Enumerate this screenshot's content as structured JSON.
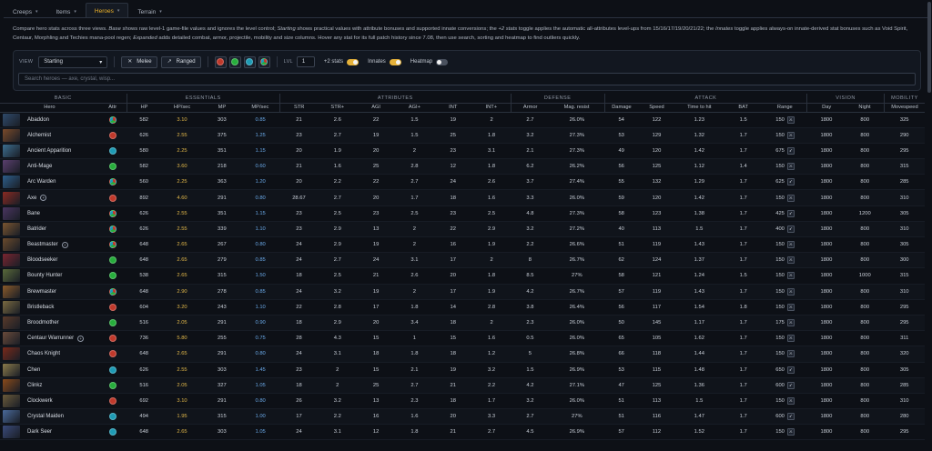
{
  "tabs": [
    {
      "label": "Creeps",
      "active": false
    },
    {
      "label": "Items",
      "active": false
    },
    {
      "label": "Heroes",
      "active": true
    },
    {
      "label": "Terrain",
      "active": false
    }
  ],
  "description_html": "Compare hero stats across three views. <i>Base</i> shows raw level-1 game-file values and ignores the level control; <i>Starting</i> shows practical values with attribute bonuses and supported innate conversions; the <i>+2 stats</i> toggle applies the automatic all-attributes level-ups from 15/16/17/19/20/21/22; the <i>Innates</i> toggle applies always-on innate-derived stat bonuses such as Void Spirit, Centaur, Morphling and Techies mana-pool regen; <i>Expanded</i> adds detailed combat, armor, projectile, mobility and size columns. Hover any stat for its full patch history since 7.08, then use search, sorting and heatmap to find outliers quickly.",
  "toolbar": {
    "view_label": "VIEW",
    "view_value": "Starting",
    "melee_label": "Melee",
    "ranged_label": "Ranged",
    "lvl_label": "LVL",
    "lvl_value": "1",
    "plus2_label": "+2 stats",
    "innates_label": "Innates",
    "heatmap_label": "Heatmap",
    "search_placeholder": "Search heroes — axe, crystal, wisp..."
  },
  "colors": {
    "str": "#c0392b",
    "agi": "#27ae3c",
    "int": "#1e9bb5",
    "accent": "#e6b23a"
  },
  "groups": [
    "BASIC",
    "ESSENTIALS",
    "ATTRIBUTES",
    "DEFENSE",
    "ATTACK",
    "VISION",
    "MOBILITY"
  ],
  "columns": [
    "Hero",
    "Attr",
    "HP",
    "HP/sec",
    "MP",
    "MP/sec",
    "STR",
    "STR+",
    "AGI",
    "AGI+",
    "INT",
    "INT+",
    "Armor",
    "Mag. resist",
    "Damage",
    "Speed",
    "Time to hit",
    "BAT",
    "Range",
    "Day",
    "Night",
    "Movespeed"
  ],
  "heroes": [
    {
      "name": "Abaddon",
      "attr": "uni",
      "innate": false,
      "pc": "#2f4a6b",
      "hp": "582",
      "hps": "3.10",
      "mp": "303",
      "mps": "0.85",
      "str": "21",
      "strg": "2.6",
      "agi": "22",
      "agig": "1.5",
      "int": "19",
      "intg": "2",
      "arm": "2.7",
      "mr": "26.0%",
      "dmg": "54",
      "spd": "122",
      "tth": "1.23",
      "bat": "1.5",
      "rng": "150",
      "day": "1800",
      "night": "800",
      "ms": "325"
    },
    {
      "name": "Alchemist",
      "attr": "str",
      "innate": false,
      "pc": "#7a4a2a",
      "hp": "626",
      "hps": "2.55",
      "mp": "375",
      "mps": "1.25",
      "str": "23",
      "strg": "2.7",
      "agi": "19",
      "agig": "1.5",
      "int": "25",
      "intg": "1.8",
      "arm": "3.2",
      "mr": "27.3%",
      "dmg": "53",
      "spd": "129",
      "tth": "1.32",
      "bat": "1.7",
      "rng": "150",
      "day": "1800",
      "night": "800",
      "ms": "290"
    },
    {
      "name": "Ancient Apparition",
      "attr": "int",
      "innate": false,
      "pc": "#3c6e8f",
      "hp": "580",
      "hps": "2.25",
      "mp": "351",
      "mps": "1.15",
      "str": "20",
      "strg": "1.9",
      "agi": "20",
      "agig": "2",
      "int": "23",
      "intg": "3.1",
      "arm": "2.1",
      "mr": "27.3%",
      "dmg": "49",
      "spd": "120",
      "tth": "1.42",
      "bat": "1.7",
      "rng": "675",
      "day": "1800",
      "night": "800",
      "ms": "295"
    },
    {
      "name": "Anti-Mage",
      "attr": "agi",
      "innate": false,
      "pc": "#5a3f6e",
      "hp": "582",
      "hps": "3.60",
      "mp": "218",
      "mps": "0.60",
      "str": "21",
      "strg": "1.6",
      "agi": "25",
      "agig": "2.8",
      "int": "12",
      "intg": "1.8",
      "arm": "6.2",
      "mr": "26.2%",
      "dmg": "56",
      "spd": "125",
      "tth": "1.12",
      "bat": "1.4",
      "rng": "150",
      "day": "1800",
      "night": "800",
      "ms": "315"
    },
    {
      "name": "Arc Warden",
      "attr": "uni",
      "innate": false,
      "pc": "#2d5e8a",
      "hp": "560",
      "hps": "2.25",
      "mp": "363",
      "mps": "1.20",
      "str": "20",
      "strg": "2.2",
      "agi": "22",
      "agig": "2.7",
      "int": "24",
      "intg": "2.6",
      "arm": "3.7",
      "mr": "27.4%",
      "dmg": "55",
      "spd": "132",
      "tth": "1.29",
      "bat": "1.7",
      "rng": "625",
      "day": "1800",
      "night": "800",
      "ms": "285"
    },
    {
      "name": "Axe",
      "attr": "str",
      "innate": true,
      "pc": "#8a2a22",
      "hp": "892",
      "hps": "4.60",
      "mp": "291",
      "mps": "0.80",
      "str": "28.67",
      "strg": "2.7",
      "agi": "20",
      "agig": "1.7",
      "int": "18",
      "intg": "1.6",
      "arm": "3.3",
      "mr": "26.0%",
      "dmg": "59",
      "spd": "120",
      "tth": "1.42",
      "bat": "1.7",
      "rng": "150",
      "day": "1800",
      "night": "800",
      "ms": "310"
    },
    {
      "name": "Bane",
      "attr": "uni",
      "innate": false,
      "pc": "#4a3560",
      "hp": "626",
      "hps": "2.55",
      "mp": "351",
      "mps": "1.15",
      "str": "23",
      "strg": "2.5",
      "agi": "23",
      "agig": "2.5",
      "int": "23",
      "intg": "2.5",
      "arm": "4.8",
      "mr": "27.3%",
      "dmg": "58",
      "spd": "123",
      "tth": "1.38",
      "bat": "1.7",
      "rng": "425",
      "day": "1800",
      "night": "1200",
      "ms": "305"
    },
    {
      "name": "Batrider",
      "attr": "uni",
      "innate": false,
      "pc": "#7a5530",
      "hp": "626",
      "hps": "2.55",
      "mp": "339",
      "mps": "1.10",
      "str": "23",
      "strg": "2.9",
      "agi": "13",
      "agig": "2",
      "int": "22",
      "intg": "2.9",
      "arm": "3.2",
      "mr": "27.2%",
      "dmg": "40",
      "spd": "113",
      "tth": "1.5",
      "bat": "1.7",
      "rng": "400",
      "day": "1800",
      "night": "800",
      "ms": "310"
    },
    {
      "name": "Beastmaster",
      "attr": "uni",
      "innate": true,
      "pc": "#6b4a2c",
      "hp": "648",
      "hps": "2.65",
      "mp": "267",
      "mps": "0.80",
      "str": "24",
      "strg": "2.9",
      "agi": "19",
      "agig": "2",
      "int": "16",
      "intg": "1.9",
      "arm": "2.2",
      "mr": "26.6%",
      "dmg": "51",
      "spd": "119",
      "tth": "1.43",
      "bat": "1.7",
      "rng": "150",
      "day": "1800",
      "night": "800",
      "ms": "305"
    },
    {
      "name": "Bloodseeker",
      "attr": "agi",
      "innate": false,
      "pc": "#7a2530",
      "hp": "648",
      "hps": "2.65",
      "mp": "279",
      "mps": "0.85",
      "str": "24",
      "strg": "2.7",
      "agi": "24",
      "agig": "3.1",
      "int": "17",
      "intg": "2",
      "arm": "8",
      "mr": "26.7%",
      "dmg": "62",
      "spd": "124",
      "tth": "1.37",
      "bat": "1.7",
      "rng": "150",
      "day": "1800",
      "night": "800",
      "ms": "300"
    },
    {
      "name": "Bounty Hunter",
      "attr": "agi",
      "innate": false,
      "pc": "#5a6a3a",
      "hp": "538",
      "hps": "2.65",
      "mp": "315",
      "mps": "1.50",
      "str": "18",
      "strg": "2.5",
      "agi": "21",
      "agig": "2.6",
      "int": "20",
      "intg": "1.8",
      "arm": "8.5",
      "mr": "27%",
      "dmg": "58",
      "spd": "121",
      "tth": "1.24",
      "bat": "1.5",
      "rng": "150",
      "day": "1800",
      "night": "1000",
      "ms": "315"
    },
    {
      "name": "Brewmaster",
      "attr": "uni",
      "innate": false,
      "pc": "#8a5a2a",
      "hp": "648",
      "hps": "2.90",
      "mp": "278",
      "mps": "0.85",
      "str": "24",
      "strg": "3.2",
      "agi": "19",
      "agig": "2",
      "int": "17",
      "intg": "1.9",
      "arm": "4.2",
      "mr": "26.7%",
      "dmg": "57",
      "spd": "119",
      "tth": "1.43",
      "bat": "1.7",
      "rng": "150",
      "day": "1800",
      "night": "800",
      "ms": "310"
    },
    {
      "name": "Bristleback",
      "attr": "str",
      "innate": false,
      "pc": "#7a6a40",
      "hp": "604",
      "hps": "3.20",
      "mp": "243",
      "mps": "1.10",
      "str": "22",
      "strg": "2.8",
      "agi": "17",
      "agig": "1.8",
      "int": "14",
      "intg": "2.8",
      "arm": "3.8",
      "mr": "26.4%",
      "dmg": "56",
      "spd": "117",
      "tth": "1.54",
      "bat": "1.8",
      "rng": "150",
      "day": "1800",
      "night": "800",
      "ms": "295"
    },
    {
      "name": "Broodmother",
      "attr": "agi",
      "innate": false,
      "pc": "#5a3a2a",
      "hp": "516",
      "hps": "2.05",
      "mp": "291",
      "mps": "0.90",
      "str": "18",
      "strg": "2.9",
      "agi": "20",
      "agig": "3.4",
      "int": "18",
      "intg": "2",
      "arm": "2.3",
      "mr": "26.0%",
      "dmg": "50",
      "spd": "145",
      "tth": "1.17",
      "bat": "1.7",
      "rng": "175",
      "day": "1800",
      "night": "800",
      "ms": "295"
    },
    {
      "name": "Centaur Warrunner",
      "attr": "str",
      "innate": true,
      "pc": "#6a4a3a",
      "hp": "736",
      "hps": "5.80",
      "mp": "255",
      "mps": "0.75",
      "str": "28",
      "strg": "4.3",
      "agi": "15",
      "agig": "1",
      "int": "15",
      "intg": "1.6",
      "arm": "0.5",
      "mr": "26.0%",
      "dmg": "65",
      "spd": "105",
      "tth": "1.62",
      "bat": "1.7",
      "rng": "150",
      "day": "1800",
      "night": "800",
      "ms": "311"
    },
    {
      "name": "Chaos Knight",
      "attr": "str",
      "innate": false,
      "pc": "#7a2a1a",
      "hp": "648",
      "hps": "2.65",
      "mp": "291",
      "mps": "0.80",
      "str": "24",
      "strg": "3.1",
      "agi": "18",
      "agig": "1.8",
      "int": "18",
      "intg": "1.2",
      "arm": "5",
      "mr": "26.8%",
      "dmg": "66",
      "spd": "118",
      "tth": "1.44",
      "bat": "1.7",
      "rng": "150",
      "day": "1800",
      "night": "800",
      "ms": "320"
    },
    {
      "name": "Chen",
      "attr": "int",
      "innate": false,
      "pc": "#8a7a4a",
      "hp": "626",
      "hps": "2.55",
      "mp": "303",
      "mps": "1.45",
      "str": "23",
      "strg": "2",
      "agi": "15",
      "agig": "2.1",
      "int": "19",
      "intg": "3.2",
      "arm": "1.5",
      "mr": "26.9%",
      "dmg": "53",
      "spd": "115",
      "tth": "1.48",
      "bat": "1.7",
      "rng": "650",
      "day": "1800",
      "night": "800",
      "ms": "305"
    },
    {
      "name": "Clinkz",
      "attr": "agi",
      "innate": false,
      "pc": "#8a4a1a",
      "hp": "516",
      "hps": "2.05",
      "mp": "327",
      "mps": "1.05",
      "str": "18",
      "strg": "2",
      "agi": "25",
      "agig": "2.7",
      "int": "21",
      "intg": "2.2",
      "arm": "4.2",
      "mr": "27.1%",
      "dmg": "47",
      "spd": "125",
      "tth": "1.36",
      "bat": "1.7",
      "rng": "600",
      "day": "1800",
      "night": "800",
      "ms": "285"
    },
    {
      "name": "Clockwerk",
      "attr": "str",
      "innate": false,
      "pc": "#6a5a3a",
      "hp": "692",
      "hps": "3.10",
      "mp": "291",
      "mps": "0.80",
      "str": "26",
      "strg": "3.2",
      "agi": "13",
      "agig": "2.3",
      "int": "18",
      "intg": "1.7",
      "arm": "3.2",
      "mr": "26.0%",
      "dmg": "51",
      "spd": "113",
      "tth": "1.5",
      "bat": "1.7",
      "rng": "150",
      "day": "1800",
      "night": "800",
      "ms": "310"
    },
    {
      "name": "Crystal Maiden",
      "attr": "int",
      "innate": false,
      "pc": "#4a6a9a",
      "hp": "494",
      "hps": "1.95",
      "mp": "315",
      "mps": "1.00",
      "str": "17",
      "strg": "2.2",
      "agi": "16",
      "agig": "1.6",
      "int": "20",
      "intg": "3.3",
      "arm": "2.7",
      "mr": "27%",
      "dmg": "51",
      "spd": "116",
      "tth": "1.47",
      "bat": "1.7",
      "rng": "600",
      "day": "1800",
      "night": "800",
      "ms": "280"
    },
    {
      "name": "Dark Seer",
      "attr": "int",
      "innate": false,
      "pc": "#3a4a7a",
      "hp": "648",
      "hps": "2.65",
      "mp": "303",
      "mps": "1.05",
      "str": "24",
      "strg": "3.1",
      "agi": "12",
      "agig": "1.8",
      "int": "21",
      "intg": "2.7",
      "arm": "4.5",
      "mr": "26.9%",
      "dmg": "57",
      "spd": "112",
      "tth": "1.52",
      "bat": "1.7",
      "rng": "150",
      "day": "1800",
      "night": "800",
      "ms": "295"
    }
  ]
}
